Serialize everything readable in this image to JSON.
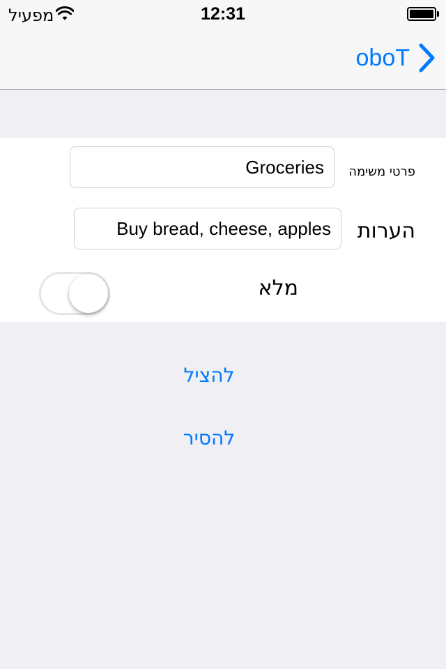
{
  "status_bar": {
    "carrier": "מפעיל",
    "time": "12:31"
  },
  "nav": {
    "back_label": "oboT"
  },
  "form": {
    "task_label": "פרטי משימה",
    "task_value": "Groceries",
    "notes_label": "הערות",
    "notes_value": "Buy bread, cheese, apples",
    "done_label": "מלא",
    "done_on": false
  },
  "actions": {
    "save": "להציל",
    "delete": "להסיר"
  },
  "colors": {
    "accent": "#007aff",
    "background": "#efeff4",
    "panel": "#ffffff"
  }
}
